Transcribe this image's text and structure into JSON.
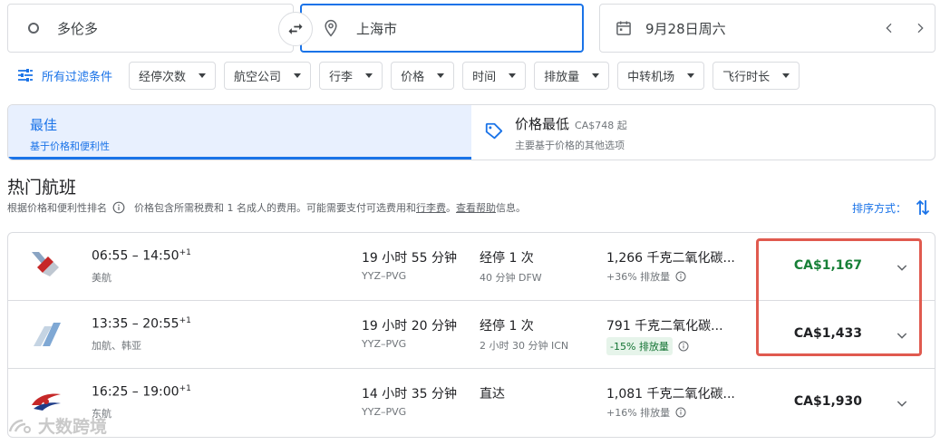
{
  "search": {
    "origin": "多伦多",
    "destination": "上海市",
    "date": "9月28日周六"
  },
  "filters": {
    "all_label": "所有过滤条件",
    "chips": [
      "经停次数",
      "航空公司",
      "行李",
      "价格",
      "时间",
      "排放量",
      "中转机场",
      "飞行时长"
    ]
  },
  "tabs": {
    "best": {
      "title": "最佳",
      "subtitle": "基于价格和便利性"
    },
    "cheapest": {
      "title": "价格最低",
      "from": "CA$748 起",
      "subtitle": "主要基于价格的其他选项"
    }
  },
  "section": {
    "heading": "热门航班",
    "note_part1": "根据价格和便利性排名",
    "note_part2": "价格包含所需税费和 1 名成人的费用。可能需要支付可选费用和",
    "note_link1": "行李费",
    "note_part3": "。",
    "note_link2": "查看帮助",
    "note_part4": "信息。",
    "sort_label": "排序方式："
  },
  "flights": [
    {
      "time": "06:55 – 14:50",
      "day_offset": "+1",
      "airline": "美航",
      "duration": "19 小时 55 分钟",
      "route": "YYZ–PVG",
      "stops": "经停 1 次",
      "stop_detail": "40 分钟 DFW",
      "co2": "1,266 千克二氧化碳...",
      "co2_delta": "+36% 排放量",
      "price": "CA$1,167"
    },
    {
      "time": "13:35 – 20:55",
      "day_offset": "+1",
      "airline": "加航、韩亚",
      "duration": "19 小时 20 分钟",
      "route": "YYZ–PVG",
      "stops": "经停 1 次",
      "stop_detail": "2 小时 30 分钟 ICN",
      "co2": "791 千克二氧化碳...",
      "co2_delta": "-15% 排放量",
      "price": "CA$1,433"
    },
    {
      "time": "16:25 – 19:00",
      "day_offset": "+1",
      "airline": "东航",
      "duration": "14 小时 35 分钟",
      "route": "YYZ–PVG",
      "stops": "直达",
      "stop_detail": "",
      "co2": "1,081 千克二氧化碳...",
      "co2_delta": "+16% 排放量",
      "price": "CA$1,930"
    }
  ],
  "watermark": "大数跨境",
  "colors": {
    "accent": "#1a73e8",
    "price_green": "#188038",
    "highlight": "#e05a4f",
    "emission_badge": "#e6f4ea"
  },
  "icons": [
    "origin-circle-icon",
    "swap-icon",
    "location-pin-icon",
    "calendar-icon",
    "chevron-left-icon",
    "chevron-right-icon",
    "filter-icon",
    "price-tag-icon",
    "info-icon",
    "sort-icon",
    "chevron-down-icon"
  ]
}
